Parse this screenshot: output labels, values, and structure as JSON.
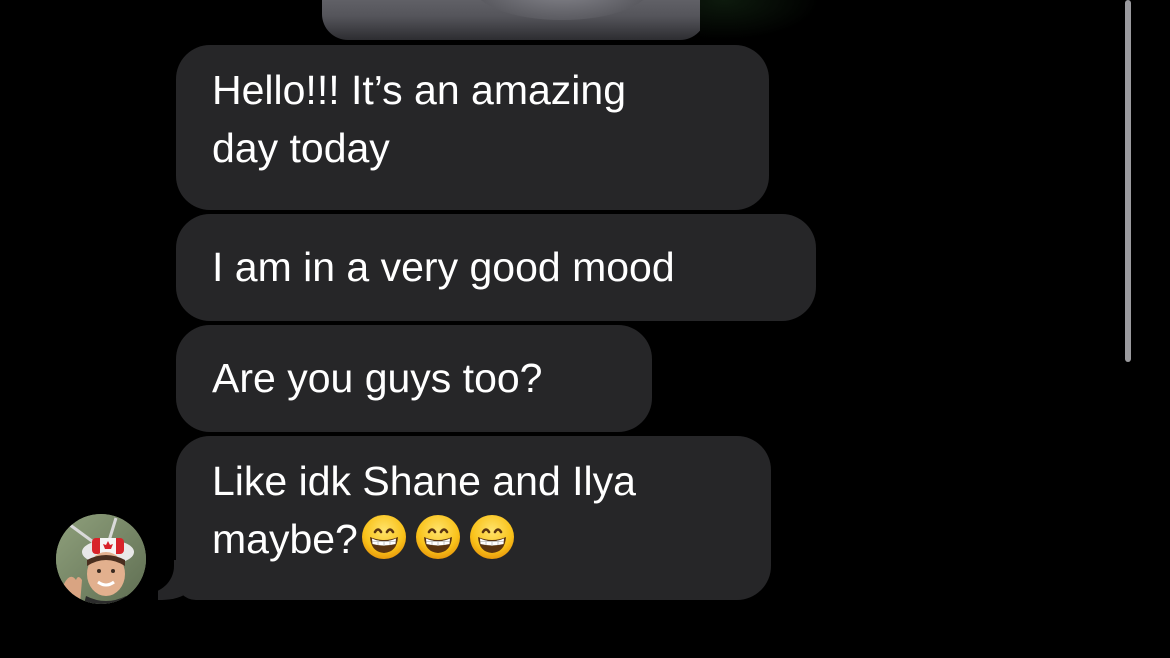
{
  "conversation": {
    "messages": [
      {
        "lines": [
          "Hello!!! It’s an amazing",
          "day today"
        ]
      },
      {
        "lines": [
          "I am in a very good mood"
        ]
      },
      {
        "lines": [
          "Are you guys too?"
        ]
      },
      {
        "lines": [
          "Like idk Shane and Ilya",
          "maybe?"
        ],
        "emoji": [
          "grinning-face",
          "grinning-face",
          "grinning-face"
        ]
      }
    ],
    "sender_avatar": "person-with-canada-hat",
    "colors": {
      "background": "#000000",
      "bubble": "#262628",
      "text": "#ffffff",
      "scrollbar": "#9a9a9e"
    }
  }
}
